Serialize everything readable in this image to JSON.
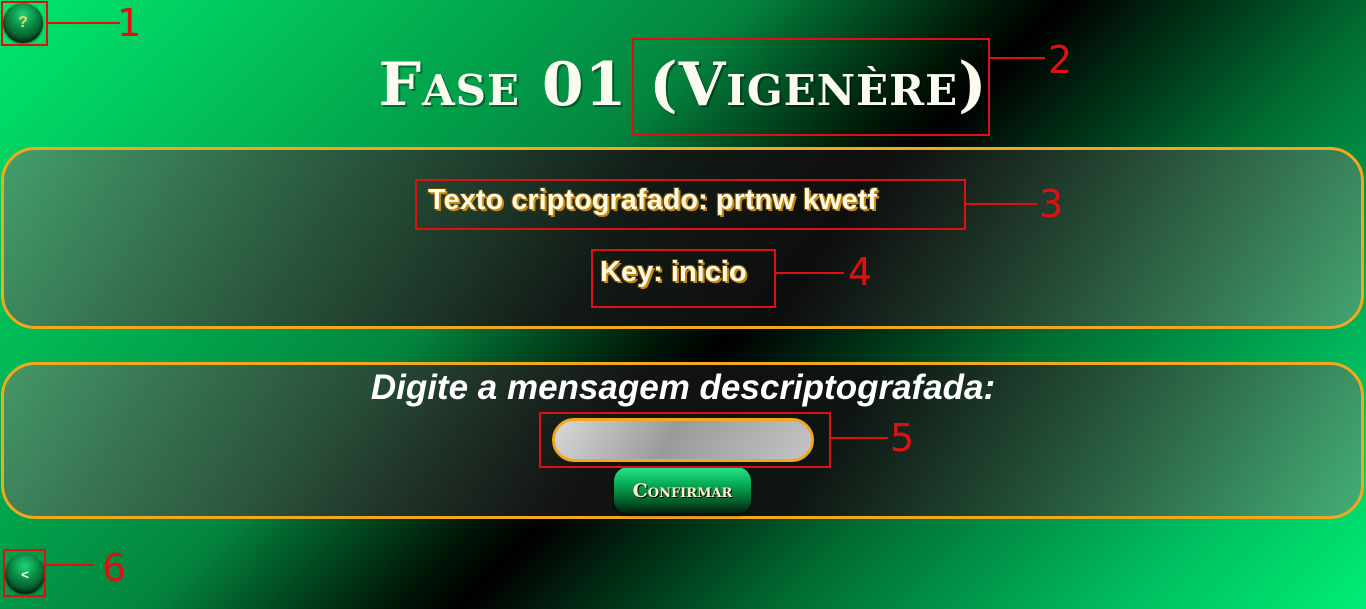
{
  "header": {
    "help_label": "?",
    "title": "Fase 01 (Vigenère)"
  },
  "info": {
    "ciphertext_label": "Texto criptografado: prtnw kwetf",
    "key_label": "Key: inicio"
  },
  "answer": {
    "prompt": "Digite a mensagem descriptografada:",
    "input_value": "",
    "confirm_label": "Confirmar"
  },
  "footer": {
    "back_label": "<"
  },
  "callouts": [
    "1",
    "2",
    "3",
    "4",
    "5",
    "6"
  ],
  "colors": {
    "panel_border": "#f2a81c",
    "annotation_red": "#e01010",
    "button_green": "#07a552"
  }
}
